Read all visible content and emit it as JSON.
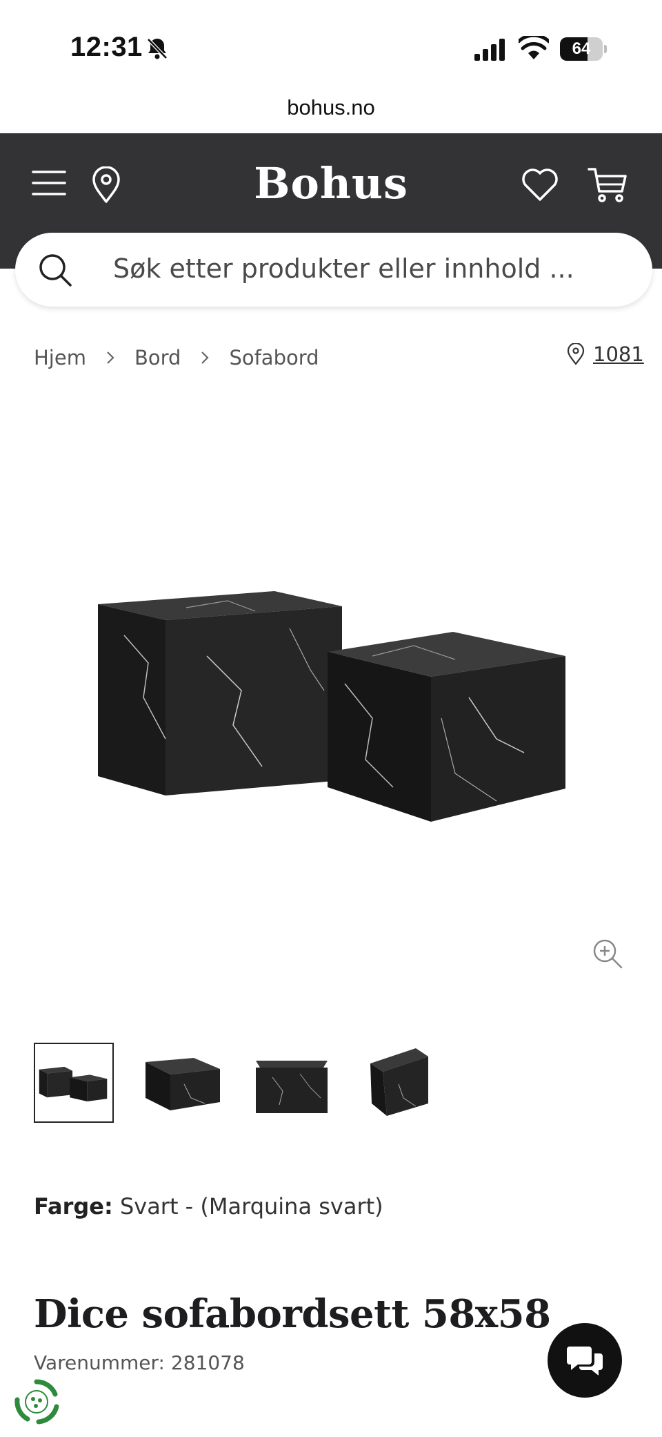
{
  "status_bar": {
    "time": "12:31",
    "battery_level": "64",
    "battery_fraction": 0.64,
    "icons": [
      "bell-slash-icon",
      "signal-icon",
      "wifi-icon",
      "battery-icon"
    ]
  },
  "browser": {
    "url": "bohus.no"
  },
  "header": {
    "logo": "Bohus",
    "icons": [
      "menu-icon",
      "location-icon",
      "heart-icon",
      "cart-icon"
    ],
    "background": "#333335"
  },
  "search": {
    "placeholder": "Søk etter produkter eller innhold ..."
  },
  "breadcrumb": {
    "items": [
      "Hjem",
      "Bord",
      "Sofabord"
    ]
  },
  "store": {
    "code": "1081"
  },
  "gallery": {
    "background": "#f4f3f1",
    "thumbnails": 4,
    "active_thumbnail": 1
  },
  "product": {
    "color_label": "Farge:",
    "color_value": "Svart - (Marquina svart)",
    "title": "Dice sofabordsett 58x58",
    "sku": "Varenummer: 281078"
  }
}
